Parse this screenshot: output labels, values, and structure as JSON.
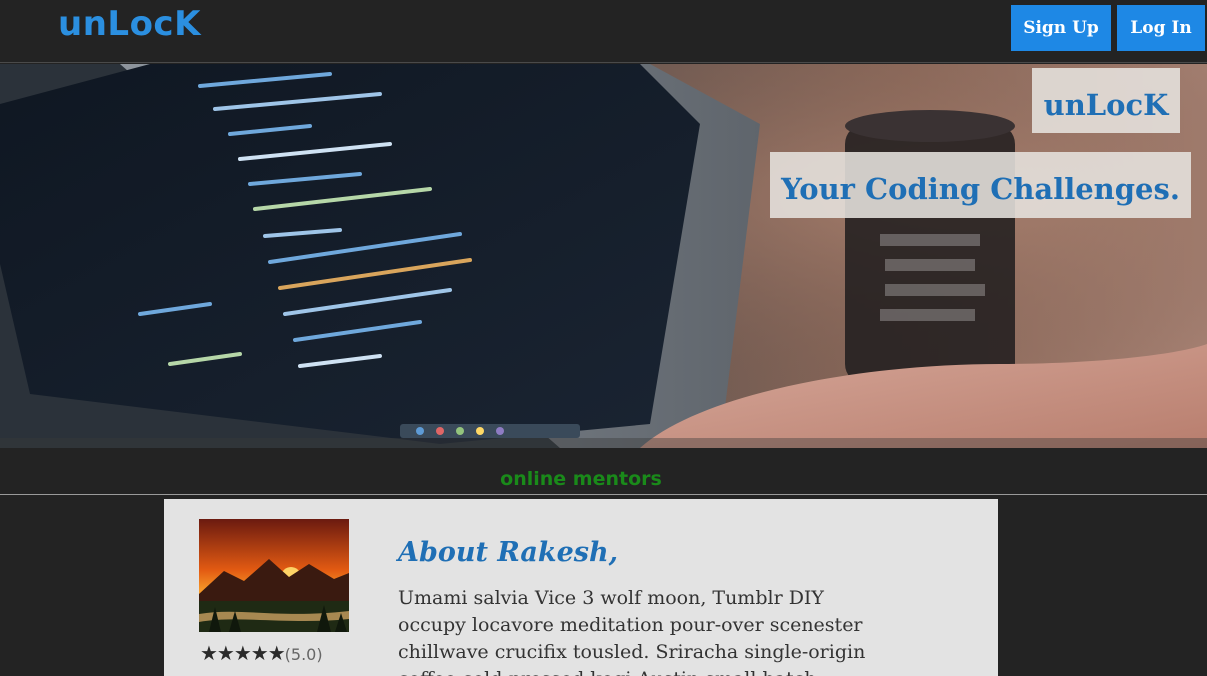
{
  "nav": {
    "brand": "unLocK",
    "signup_label": "Sign Up",
    "login_label": "Log In"
  },
  "hero": {
    "brand": "unLocK",
    "tagline": "Your Coding Challenges."
  },
  "section": {
    "title": "online mentors"
  },
  "mentor": {
    "about_title": "About Rakesh,",
    "stars": "★★★★★",
    "rating": "(5.0)",
    "bio": "Umami salvia Vice 3 wolf moon, Tumblr DIY occupy locavore meditation pour-over scenester chillwave crucifix tousled. Sriracha single-origin coffee cold-pressed kogi Austin small batch."
  },
  "colors": {
    "accent": "#1e88e5",
    "brand": "#2b8fe0",
    "section_title": "#1a8a1a",
    "background": "#232323"
  }
}
